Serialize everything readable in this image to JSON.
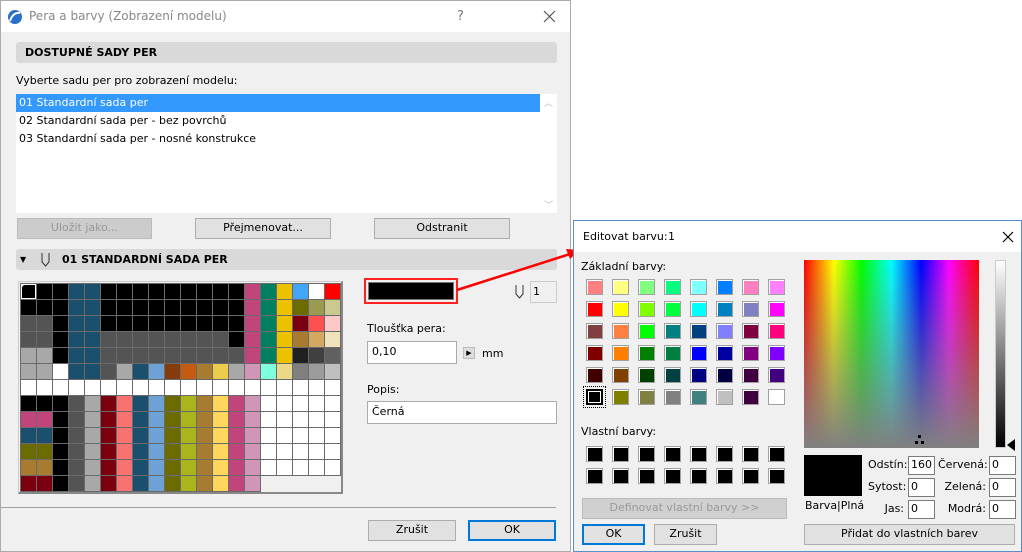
{
  "main": {
    "title": "Pera a barvy (Zobrazení modelu)",
    "help": "?",
    "section1": "DOSTUPNÉ SADY PER",
    "prompt": "Vyberte sadu per pro zobrazení modelu:",
    "sets": [
      "01 Standardní sada per",
      "02 Standardní sada per - bez povrchů",
      "03 Standardní sada per - nosné konstrukce"
    ],
    "selected_set": 0,
    "save_as": "Uložit jako...",
    "rename": "Přejmenovat...",
    "delete": "Odstranit",
    "section2": "01 STANDARDNÍ SADA PER",
    "pen_number": "1",
    "pen_color": "#000000",
    "thickness_label": "Tloušťka pera:",
    "thickness": "0,10",
    "unit": "mm",
    "desc_label": "Popis:",
    "desc": "Černá",
    "cancel": "Zrušit",
    "ok": "OK",
    "pen_grid": [
      [
        "#000000",
        "#000000",
        "#000000",
        "#1b4f6e",
        "#1b4f6e",
        "#000000",
        "#000000",
        "#000000",
        "#000000",
        "#000000",
        "#000000",
        "#000000",
        "#000000",
        "#000000",
        "#c1457a",
        "#008060",
        "#ecc200",
        "#42a5f5",
        "#ffffff",
        "#ff0000"
      ],
      [
        "#000000",
        "#000000",
        "#000000",
        "#1b4f6e",
        "#1b4f6e",
        "#000000",
        "#000000",
        "#000000",
        "#000000",
        "#000000",
        "#000000",
        "#000000",
        "#000000",
        "#000000",
        "#c1457a",
        "#008060",
        "#ecc200",
        "#6b6b00",
        "#9a9a50",
        "#caca90"
      ],
      [
        "#545454",
        "#545454",
        "#000000",
        "#1b4f6e",
        "#1b4f6e",
        "#000000",
        "#000000",
        "#000000",
        "#000000",
        "#000000",
        "#000000",
        "#000000",
        "#000000",
        "#000000",
        "#c1457a",
        "#008060",
        "#ecc200",
        "#7a0010",
        "#ff5050",
        "#ffc8c8"
      ],
      [
        "#545454",
        "#545454",
        "#000000",
        "#1b4f6e",
        "#1b4f6e",
        "#545454",
        "#545454",
        "#545454",
        "#545454",
        "#545454",
        "#545454",
        "#545454",
        "#545454",
        "#000000",
        "#c1457a",
        "#008060",
        "#ecc200",
        "#a87c30",
        "#d4a860",
        "#efe3bb"
      ],
      [
        "#a8a8a8",
        "#a8a8a8",
        "#000000",
        "#1b4f6e",
        "#1b4f6e",
        "#545454",
        "#545454",
        "#545454",
        "#545454",
        "#545454",
        "#545454",
        "#545454",
        "#545454",
        "#545454",
        "#c1457a",
        "#008060",
        "#ecc200",
        "#202020",
        "#404040",
        "#606060"
      ],
      [
        "#a8a8a8",
        "#a8a8a8",
        "#ffffff",
        "#1b4f6e",
        "#1b4f6e",
        "#545454",
        "#a8a8a8",
        "#1b4f6e",
        "#6ea2d6",
        "#843c0c",
        "#c55a11",
        "#a87c30",
        "#ebcc4c",
        "#a8a8a8",
        "#d096b8",
        "#80ffdf",
        "#ecd988",
        "#808080",
        "#9c9c9c",
        "#bfbfbf"
      ],
      [
        "#ffffff",
        "#ffffff",
        "#ffffff",
        "#ffffff",
        "#ffffff",
        "#ffffff",
        "#ffffff",
        "#ffffff",
        "#ffffff",
        "#ffffff",
        "#ffffff",
        "#ffffff",
        "#ffffff",
        "#ffffff",
        "#ffffff",
        "#ffffff",
        "#ffffff",
        "#ffffff",
        "#ffffff",
        "#ffffff"
      ],
      [
        "#000000",
        "#000000",
        "#000000",
        "#545454",
        "#a8a8a8",
        "#7a0010",
        "#f97272",
        "#1b4f6e",
        "#6ea2d6",
        "#6b6b00",
        "#aab51c",
        "#a87c30",
        "#ffd65c",
        "#c1457a",
        "#d096b8",
        "#ffffff",
        "#ffffff",
        "#ffffff",
        "#ffffff",
        "#ffffff"
      ],
      [
        "#c1457a",
        "#c1457a",
        "#000000",
        "#545454",
        "#a8a8a8",
        "#7a0010",
        "#f97272",
        "#1b4f6e",
        "#6ea2d6",
        "#6b6b00",
        "#aab51c",
        "#a87c30",
        "#ffd65c",
        "#c1457a",
        "#d096b8",
        "#ffffff",
        "#ffffff",
        "#ffffff",
        "#ffffff",
        "#ffffff"
      ],
      [
        "#1b4f6e",
        "#1b4f6e",
        "#000000",
        "#545454",
        "#a8a8a8",
        "#7a0010",
        "#f97272",
        "#1b4f6e",
        "#6ea2d6",
        "#6b6b00",
        "#aab51c",
        "#a87c30",
        "#ffd65c",
        "#c1457a",
        "#d096b8",
        "#ffffff",
        "#ffffff",
        "#ffffff",
        "#ffffff",
        "#ffffff"
      ],
      [
        "#6b6b00",
        "#6b6b00",
        "#000000",
        "#545454",
        "#a8a8a8",
        "#7a0010",
        "#f97272",
        "#1b4f6e",
        "#6ea2d6",
        "#6b6b00",
        "#aab51c",
        "#a87c30",
        "#ffd65c",
        "#c1457a",
        "#d096b8",
        "#ffffff",
        "#ffffff",
        "#ffffff",
        "#ffffff",
        "#ffffff"
      ],
      [
        "#a87c30",
        "#a87c30",
        "#000000",
        "#545454",
        "#a8a8a8",
        "#7a0010",
        "#f97272",
        "#1b4f6e",
        "#6ea2d6",
        "#6b6b00",
        "#aab51c",
        "#a87c30",
        "#ffd65c",
        "#c1457a",
        "#d096b8",
        "#ffffff",
        "#ffffff",
        "#ffffff",
        "#ffffff",
        "#ffffff"
      ],
      [
        "#7a0010",
        "#7a0010",
        "#000000",
        "#545454",
        "#a8a8a8",
        "#7a0010",
        "#f97272",
        "#1b4f6e",
        "#6ea2d6",
        "#6b6b00",
        "#aab51c",
        "#a87c30",
        "#ffd65c",
        "#c1457a",
        "#d096b8"
      ]
    ]
  },
  "color_dialog": {
    "title": "Editovat barvu:",
    "pen_index": "1",
    "basic_label": "Základní barvy:",
    "basic_colors": [
      [
        "#ff8080",
        "#ffff80",
        "#80ff80",
        "#00ff80",
        "#80ffff",
        "#0080ff",
        "#ff80c0",
        "#ff80ff"
      ],
      [
        "#ff0000",
        "#ffff00",
        "#80ff00",
        "#00ff40",
        "#00ffff",
        "#0080c0",
        "#8080c0",
        "#ff00ff"
      ],
      [
        "#804040",
        "#ff8040",
        "#00ff00",
        "#008080",
        "#004080",
        "#8080ff",
        "#800040",
        "#ff0080"
      ],
      [
        "#800000",
        "#ff8000",
        "#008000",
        "#008040",
        "#0000ff",
        "#0000a0",
        "#800080",
        "#8000ff"
      ],
      [
        "#400000",
        "#804000",
        "#004000",
        "#004040",
        "#000080",
        "#000040",
        "#400040",
        "#400080"
      ],
      [
        "#000000",
        "#808000",
        "#808040",
        "#808080",
        "#408080",
        "#c0c0c0",
        "#400040",
        "#ffffff"
      ]
    ],
    "custom_label": "Vlastní barvy:",
    "custom_colors": [
      "#000000",
      "#000000",
      "#000000",
      "#000000",
      "#000000",
      "#000000",
      "#000000",
      "#000000",
      "#000000",
      "#000000",
      "#000000",
      "#000000",
      "#000000",
      "#000000",
      "#000000",
      "#000000"
    ],
    "define_custom": "Definovat vlastní barvy >>",
    "ok": "OK",
    "cancel": "Zrušit",
    "preview_label": "Barva|Plná",
    "hue_label": "Odstín:",
    "hue": "160",
    "sat_label": "Sytost:",
    "sat": "0",
    "lum_label": "Jas:",
    "lum": "0",
    "red_label": "Červená:",
    "red": "0",
    "green_label": "Zelená:",
    "green": "0",
    "blue_label": "Modrá:",
    "blue": "0",
    "add_custom": "Přidat do vlastních barev",
    "current_color": "#000000"
  }
}
